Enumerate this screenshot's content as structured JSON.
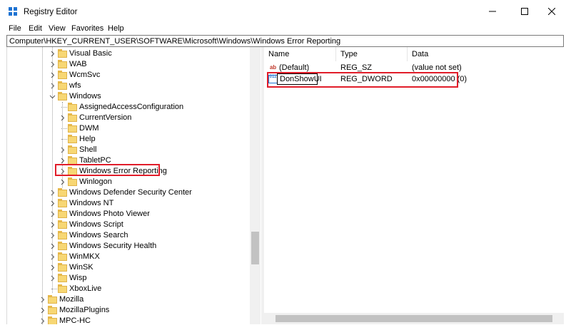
{
  "window": {
    "title": "Registry Editor"
  },
  "menu": [
    "File",
    "Edit",
    "View",
    "Favorites",
    "Help"
  ],
  "address": "Computer\\HKEY_CURRENT_USER\\SOFTWARE\\Microsoft\\Windows\\Windows Error Reporting",
  "tree": {
    "items": [
      {
        "label": "Visual Basic",
        "expander": "collapsed"
      },
      {
        "label": "WAB",
        "expander": "collapsed"
      },
      {
        "label": "WcmSvc",
        "expander": "collapsed"
      },
      {
        "label": "wfs",
        "expander": "collapsed"
      },
      {
        "label": "Windows",
        "expander": "expanded"
      },
      {
        "label": "AssignedAccessConfiguration",
        "expander": "none"
      },
      {
        "label": "CurrentVersion",
        "expander": "collapsed"
      },
      {
        "label": "DWM",
        "expander": "none"
      },
      {
        "label": "Help",
        "expander": "none"
      },
      {
        "label": "Shell",
        "expander": "collapsed"
      },
      {
        "label": "TabletPC",
        "expander": "collapsed"
      },
      {
        "label": "Windows Error Reporting",
        "expander": "collapsed",
        "selected": true
      },
      {
        "label": "Winlogon",
        "expander": "collapsed"
      },
      {
        "label": "Windows Defender Security Center",
        "expander": "collapsed"
      },
      {
        "label": "Windows NT",
        "expander": "collapsed"
      },
      {
        "label": "Windows Photo Viewer",
        "expander": "collapsed"
      },
      {
        "label": "Windows Script",
        "expander": "collapsed"
      },
      {
        "label": "Windows Search",
        "expander": "collapsed"
      },
      {
        "label": "Windows Security Health",
        "expander": "collapsed"
      },
      {
        "label": "WinMKX",
        "expander": "collapsed"
      },
      {
        "label": "WinSK",
        "expander": "collapsed"
      },
      {
        "label": "Wisp",
        "expander": "collapsed"
      },
      {
        "label": "XboxLive",
        "expander": "none"
      },
      {
        "label": "Mozilla",
        "expander": "collapsed"
      },
      {
        "label": "MozillaPlugins",
        "expander": "collapsed"
      },
      {
        "label": "MPC-HC",
        "expander": "collapsed"
      }
    ]
  },
  "list": {
    "columns": [
      "Name",
      "Type",
      "Data"
    ],
    "rows": [
      {
        "icon": "string-value-icon",
        "icon_glyph": "ab",
        "name": "(Default)",
        "type": "REG_SZ",
        "data": "(value not set)"
      },
      {
        "icon": "dword-value-icon",
        "icon_glyph": "011",
        "name": "DonShowUI",
        "type": "REG_DWORD",
        "data": "0x00000000 (0)",
        "renaming": true
      }
    ]
  },
  "colors": {
    "highlight": "#e11d2a",
    "folder": "#f7d774",
    "accent": "#1e73d2"
  }
}
